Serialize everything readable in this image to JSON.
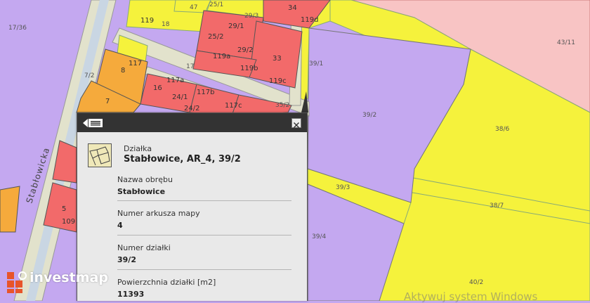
{
  "map": {
    "road_label": "Stabłowicka",
    "parcel_labels": {
      "p_17_36": "17/36",
      "p_7_2": "7/2",
      "p_8": "8",
      "p_7": "7",
      "p_5": "5",
      "p_109": "109",
      "p_119": "119",
      "p_18": "18",
      "p_117": "117",
      "p_17": "17",
      "p_16": "16",
      "p_117a": "117a",
      "p_24_1": "24/1",
      "p_117b": "117b",
      "p_24_2": "24/2",
      "p_117c": "117c",
      "p_47": "47",
      "p_25_1": "25/1",
      "p_29_3": "29/3",
      "p_34": "34",
      "p_119d": "119d",
      "p_25_2": "25/2",
      "p_29_1": "29/1",
      "p_119a": "119a",
      "p_29_2": "29/2",
      "p_119b": "119b",
      "p_33": "33",
      "p_119c": "119c",
      "p_35_2": "35/2",
      "p_39_1": "39/1",
      "p_39_2": "39/2",
      "p_43_11": "43/11",
      "p_38_6": "38/6",
      "p_39_3": "39/3",
      "p_38_7": "38/7",
      "p_39_4": "39/4",
      "p_40_2": "40/2"
    },
    "colors": {
      "purple": "#c4a8f0",
      "yellow": "#f5f23c",
      "red": "#f26a6a",
      "orange": "#f5aa3c",
      "pink": "#f8c4c4",
      "road": "#e2e2cc"
    }
  },
  "popup": {
    "type_label": "Działka",
    "title": "Stabłowice, AR_4, 39/2",
    "fields": [
      {
        "label": "Nazwa obrębu",
        "value": "Stabłowice"
      },
      {
        "label": "Numer arkusza mapy",
        "value": "4"
      },
      {
        "label": "Numer działki",
        "value": "39/2"
      },
      {
        "label": "Powierzchnia działki [m2]",
        "value": "11393"
      }
    ]
  },
  "branding": {
    "logo_text": "investmap",
    "logo_icon": "investmap-logo-icon"
  },
  "watermark": "Aktywuj system Windows"
}
